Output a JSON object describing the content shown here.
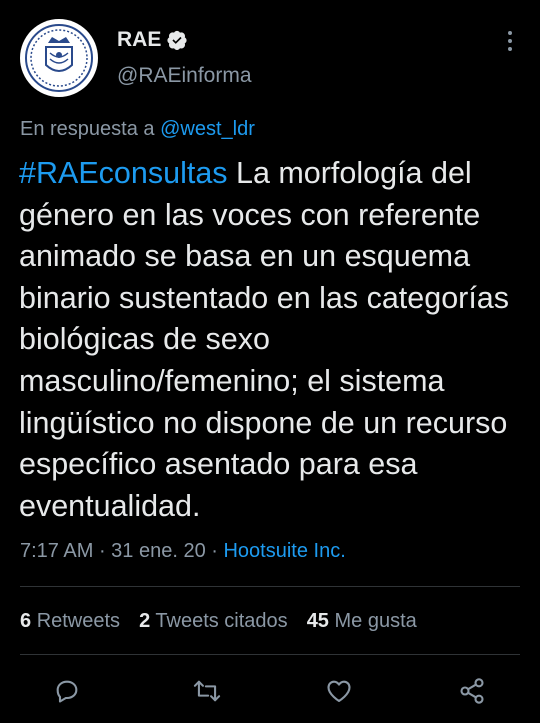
{
  "user": {
    "name": "RAE",
    "handle": "@RAEinforma"
  },
  "reply": {
    "prefix": "En respuesta a",
    "to": "@west_ldr"
  },
  "tweet": {
    "hashtag": "#RAEconsultas",
    "text": " La morfología del género en las voces con referente animado se basa en un esquema binario sustentado en las categorías biológicas de sexo masculino/femenino; el sistema lingüístico no dispone de un recurso específico asentado para esa eventualidad."
  },
  "meta": {
    "time": "7:17 AM",
    "date": "31 ene. 20",
    "sep": " · ",
    "source": "Hootsuite Inc."
  },
  "stats": {
    "retweets_count": "6",
    "retweets_label": "Retweets",
    "quotes_count": "2",
    "quotes_label": "Tweets citados",
    "likes_count": "45",
    "likes_label": "Me gusta"
  },
  "icons": {
    "verified": "verified-badge-icon",
    "more": "more-vertical-icon",
    "reply": "reply-icon",
    "retweet": "retweet-icon",
    "like": "heart-icon",
    "share": "share-icon"
  },
  "colors": {
    "background": "#000000",
    "text": "#e7e9ea",
    "secondary": "#8b98a5",
    "accent": "#1d9bf0"
  }
}
